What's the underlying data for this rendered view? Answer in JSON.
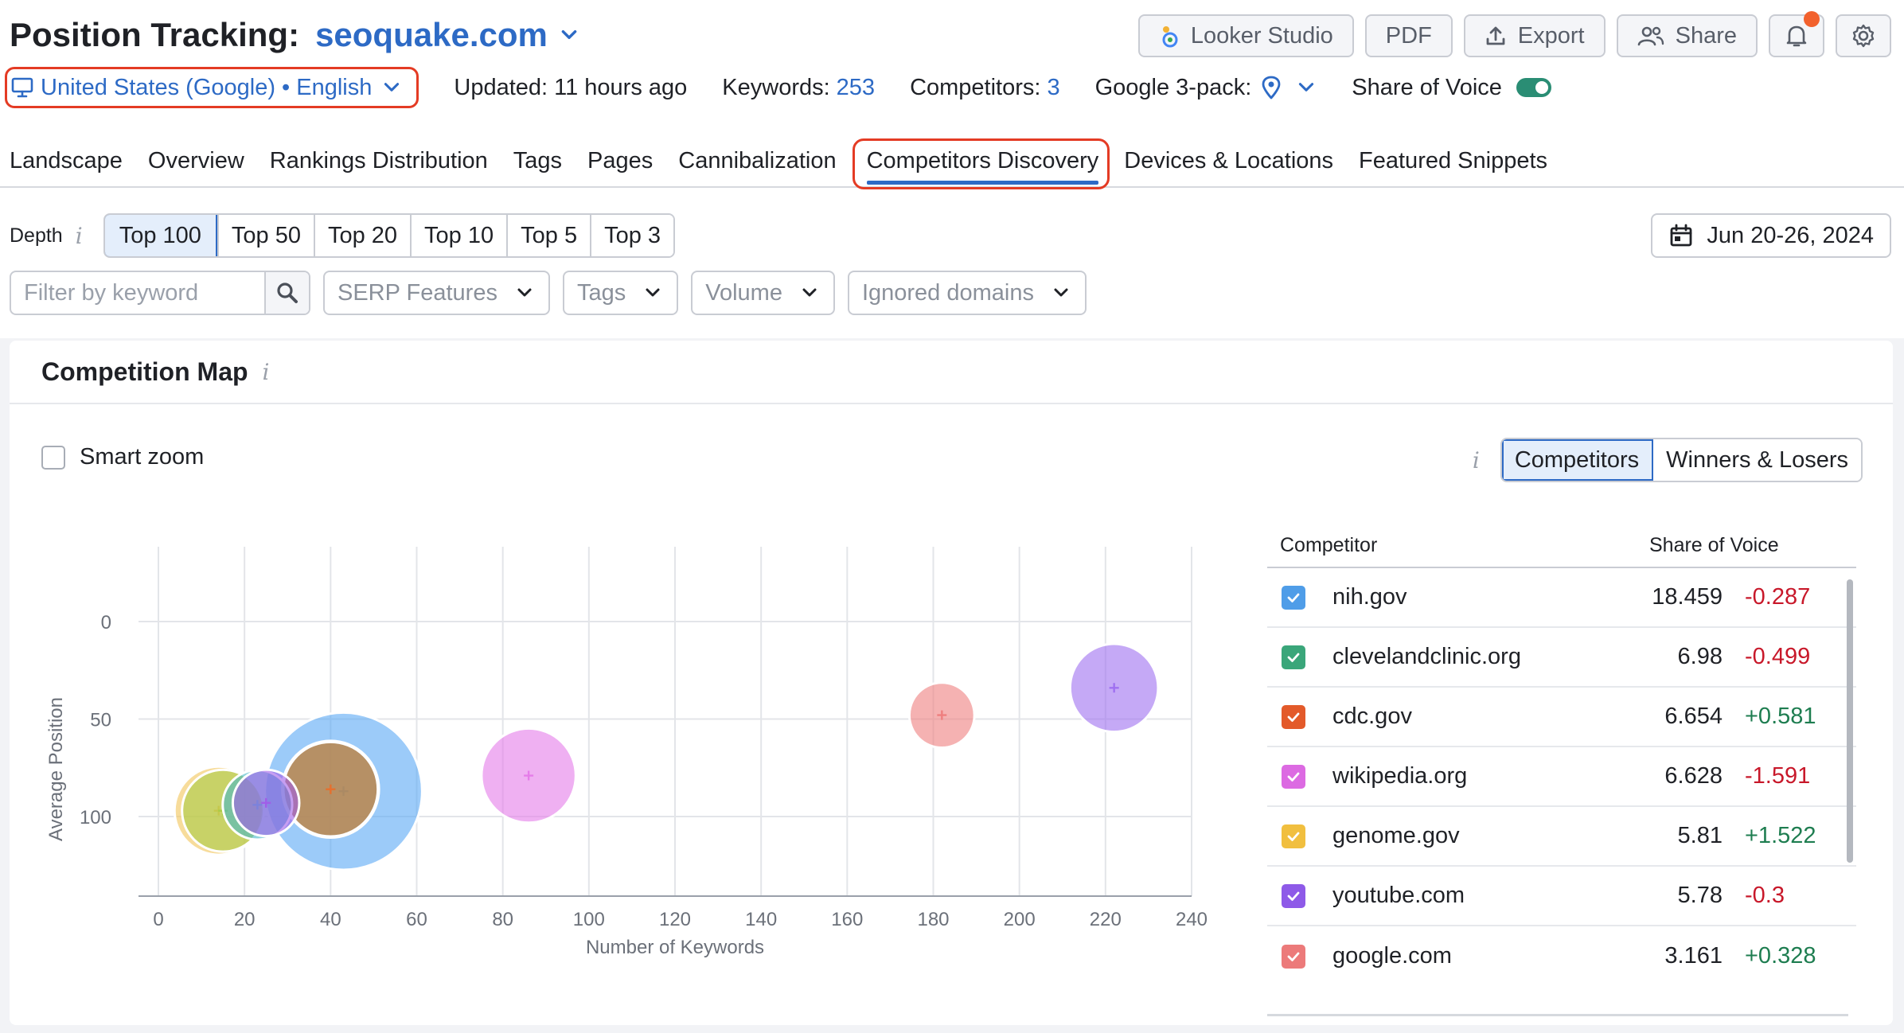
{
  "header": {
    "title": "Position Tracking:",
    "domain": "seoquake.com",
    "actions": {
      "looker": "Looker Studio",
      "pdf": "PDF",
      "export": "Export",
      "share": "Share"
    }
  },
  "info_bar": {
    "location": "United States (Google) • English",
    "updated": "Updated: 11 hours ago",
    "keywords_label": "Keywords:",
    "keywords_value": "253",
    "competitors_label": "Competitors:",
    "competitors_value": "3",
    "google3pack_label": "Google 3-pack:",
    "sov_label": "Share of Voice",
    "sov_enabled": true
  },
  "tabs": [
    {
      "label": "Landscape",
      "active": false
    },
    {
      "label": "Overview",
      "active": false
    },
    {
      "label": "Rankings Distribution",
      "active": false
    },
    {
      "label": "Tags",
      "active": false
    },
    {
      "label": "Pages",
      "active": false
    },
    {
      "label": "Cannibalization",
      "active": false
    },
    {
      "label": "Competitors Discovery",
      "active": true
    },
    {
      "label": "Devices & Locations",
      "active": false
    },
    {
      "label": "Featured Snippets",
      "active": false
    }
  ],
  "depth": {
    "label": "Depth",
    "options": [
      "Top 100",
      "Top 50",
      "Top 20",
      "Top 10",
      "Top 5",
      "Top 3"
    ],
    "selected": "Top 100"
  },
  "date_range": "Jun 20-26, 2024",
  "filters": {
    "keyword_placeholder": "Filter by keyword",
    "serp": "SERP Features",
    "tags": "Tags",
    "volume": "Volume",
    "ignored": "Ignored domains"
  },
  "card": {
    "title": "Competition Map",
    "smart_zoom": "Smart zoom",
    "view_options": [
      "Competitors",
      "Winners & Losers"
    ],
    "view_selected": "Competitors"
  },
  "chart_data": {
    "type": "scatter",
    "xlabel": "Number of Keywords",
    "ylabel": "Average Position",
    "xlim": [
      0,
      240
    ],
    "ylim": [
      100,
      0
    ],
    "xticks": [
      "0",
      "20",
      "40",
      "60",
      "80",
      "100",
      "120",
      "140",
      "160",
      "180",
      "200",
      "220",
      "240"
    ],
    "yticks": [
      "0",
      "50",
      "100"
    ],
    "grid": true,
    "points": [
      {
        "x": 43,
        "y": 87,
        "size": 18.459,
        "color": "#5aa8f5"
      },
      {
        "x": 40,
        "y": 86,
        "size": 6.98,
        "color": "#54b98a"
      },
      {
        "x": 40,
        "y": 86,
        "size": 6.654,
        "color": "#e5702f"
      },
      {
        "x": 86,
        "y": 79,
        "size": 6.628,
        "color": "#e57ce9"
      },
      {
        "x": 14,
        "y": 97,
        "size": 5.81,
        "color": "#f2c458"
      },
      {
        "x": 222,
        "y": 34,
        "size": 5.78,
        "color": "#9f70f0"
      },
      {
        "x": 182,
        "y": 48,
        "size": 3.161,
        "color": "#ef7f7f"
      },
      {
        "x": 15,
        "y": 97,
        "size": 5.0,
        "color": "#a9cc45"
      },
      {
        "x": 23,
        "y": 94,
        "size": 3.6,
        "color": "#46b8c8"
      },
      {
        "x": 25,
        "y": 93,
        "size": 3.3,
        "color": "#a05ee8"
      }
    ]
  },
  "table": {
    "col_competitor": "Competitor",
    "col_sov": "Share of Voice",
    "rows": [
      {
        "name": "nih.gov",
        "sov": "18.459",
        "change": "-0.287",
        "color": "#4f9de8"
      },
      {
        "name": "clevelandclinic.org",
        "sov": "6.98",
        "change": "-0.499",
        "color": "#3aa67a"
      },
      {
        "name": "cdc.gov",
        "sov": "6.654",
        "change": "+0.581",
        "color": "#e35a2a"
      },
      {
        "name": "wikipedia.org",
        "sov": "6.628",
        "change": "-1.591",
        "color": "#dc6ae2"
      },
      {
        "name": "genome.gov",
        "sov": "5.81",
        "change": "+1.522",
        "color": "#f1bf3f"
      },
      {
        "name": "youtube.com",
        "sov": "5.78",
        "change": "-0.3",
        "color": "#8e5ae8"
      },
      {
        "name": "google.com",
        "sov": "3.161",
        "change": "+0.328",
        "color": "#ec7a7a"
      }
    ]
  }
}
